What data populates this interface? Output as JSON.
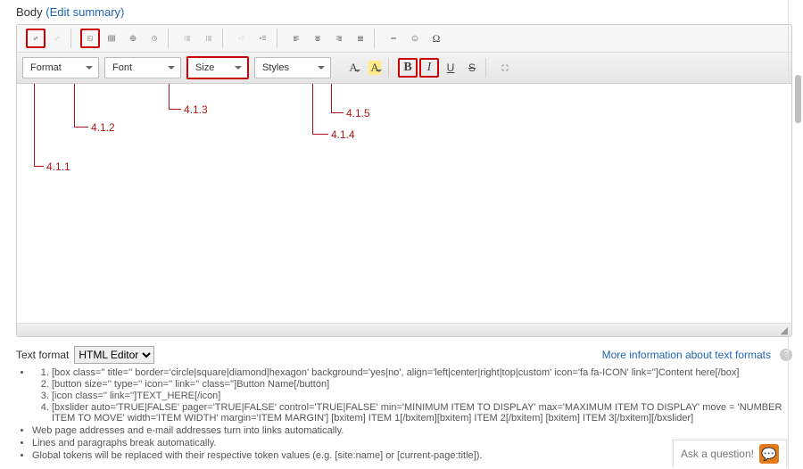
{
  "header": {
    "body_label": "Body",
    "edit_summary": "(Edit summary)"
  },
  "toolbar": {
    "format_label": "Format",
    "font_label": "Font",
    "size_label": "Size",
    "styles_label": "Styles",
    "bold_glyph": "B",
    "italic_glyph": "I",
    "underline_glyph": "U",
    "strike_glyph": "S",
    "letterA": "A"
  },
  "callouts": {
    "c411": "4.1.1",
    "c412": "4.1.2",
    "c413": "4.1.3",
    "c414": "4.1.4",
    "c415": "4.1.5"
  },
  "textformat": {
    "label": "Text format",
    "selected": "HTML Editor",
    "more_info": "More information about text formats"
  },
  "hints": {
    "inner": [
      "[box class='' title='' border='circle|square|diamond|hexagon' background='yes|no', align='left|center|right|top|custom' icon='fa fa-ICON' link='']Content here[/box]",
      "[button size='' type='' icon='' link='' class='']Button Name[/button]",
      "[icon class='' link='']TEXT_HERE[/icon]",
      "[bxslider auto='TRUE|FALSE' pager='TRUE|FALSE' control='TRUE|FALSE' min='MINIMUM ITEM TO DISPLAY' max='MAXIMUM ITEM TO DISPLAY' move = 'NUMBER ITEM TO MOVE' width='ITEM WIDTH' margin='ITEM MARGIN'] [bxitem] ITEM 1[/bxitem][bxitem] ITEM 2[/bxitem] [bxitem] ITEM 3[/bxitem][/bxslider]"
    ],
    "outer": [
      "Web page addresses and e-mail addresses turn into links automatically.",
      "Lines and paragraphs break automatically.",
      "Global tokens will be replaced with their respective token values (e.g. [site:name] or [current-page:title])."
    ]
  },
  "ask": {
    "label": "Ask a question!"
  }
}
